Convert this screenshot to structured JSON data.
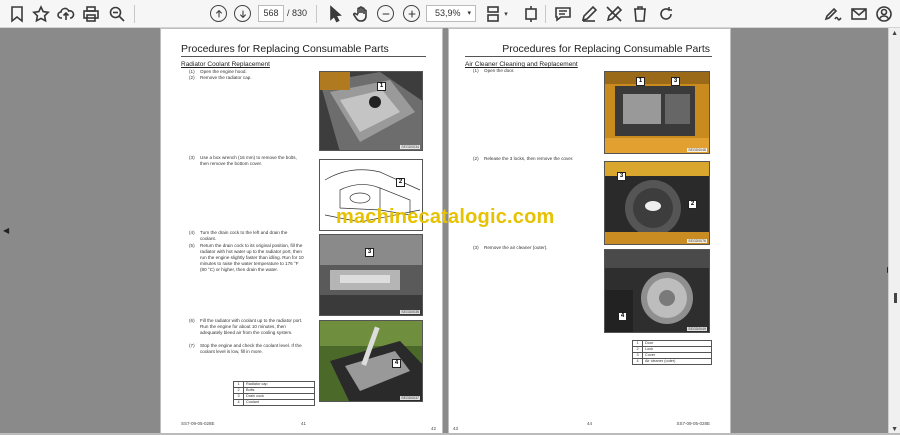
{
  "toolbar": {
    "current_page": "568",
    "page_sep": "/ 830",
    "zoom": "53,9%"
  },
  "left_page": {
    "title": "Procedures for Replacing Consumable Parts",
    "subtitle": "Radiator Coolant Replacement",
    "steps": [
      {
        "n": "(1)",
        "t": "Open the engine hood."
      },
      {
        "n": "(2)",
        "t": "Remove the radiator cap."
      },
      {
        "n": "(3)",
        "t": "Use a box wrench (16 mm) to remove the bolts, then remove the bottom cover."
      },
      {
        "n": "(4)",
        "t": "Turn the drain cock to the left and drain the coolant."
      },
      {
        "n": "(5)",
        "t": "Return the drain cock to its original position, fill the radiator with hot water up to the radiator port, then run the engine slightly faster than idling. Run for 10 minutes to raise the water temperature to 176 °F (80 °C) or higher, then drain the water."
      },
      {
        "n": "(6)",
        "t": "Fill the radiator with coolant up to the radiator port. Run the engine for about 10 minutes, then adequately bleed air from the cooling system."
      },
      {
        "n": "(7)",
        "t": "Stop the engine and check the coolant level. If the coolant level is low, fill in more."
      }
    ],
    "photos": [
      {
        "callout": "1",
        "code": "SEGD0034"
      },
      {
        "callout": "2",
        "code": ""
      },
      {
        "callout": "3",
        "code": "SEGD0035"
      },
      {
        "callout": "4",
        "code": "SEGD0037"
      }
    ],
    "legend": [
      {
        "n": "1",
        "t": "Radiator cap"
      },
      {
        "n": "2",
        "t": "Bolts"
      },
      {
        "n": "3",
        "t": "Drain cock"
      },
      {
        "n": "4",
        "t": "Coolant"
      }
    ],
    "footer_left": "SS7-09-05-028E",
    "footer_mid": "41",
    "footer_right": "42"
  },
  "right_page": {
    "title": "Procedures for Replacing Consumable Parts",
    "subtitle": "Air Cleaner Cleaning and Replacement",
    "steps": [
      {
        "n": "(1)",
        "t": "Open the door."
      },
      {
        "n": "(2)",
        "t": "Release the 3 locks, then remove the cover."
      },
      {
        "n": "(3)",
        "t": "Remove the air cleaner (outer)."
      }
    ],
    "photos": [
      {
        "callout": "1",
        "callout2": "3",
        "code": "SEGD0048"
      },
      {
        "callout": "3",
        "callout2": "2",
        "code": "SEGD0076"
      },
      {
        "callout": "4",
        "code": "SEGD0049"
      }
    ],
    "legend": [
      {
        "n": "1",
        "t": "Door"
      },
      {
        "n": "2",
        "t": "Lock"
      },
      {
        "n": "3",
        "t": "Cover"
      },
      {
        "n": "4",
        "t": "Air cleaner (outer)"
      }
    ],
    "footer_left": "43",
    "footer_mid": "44",
    "footer_right": "SS7-09-05-028E"
  },
  "watermark": "machinecatalogic.com"
}
